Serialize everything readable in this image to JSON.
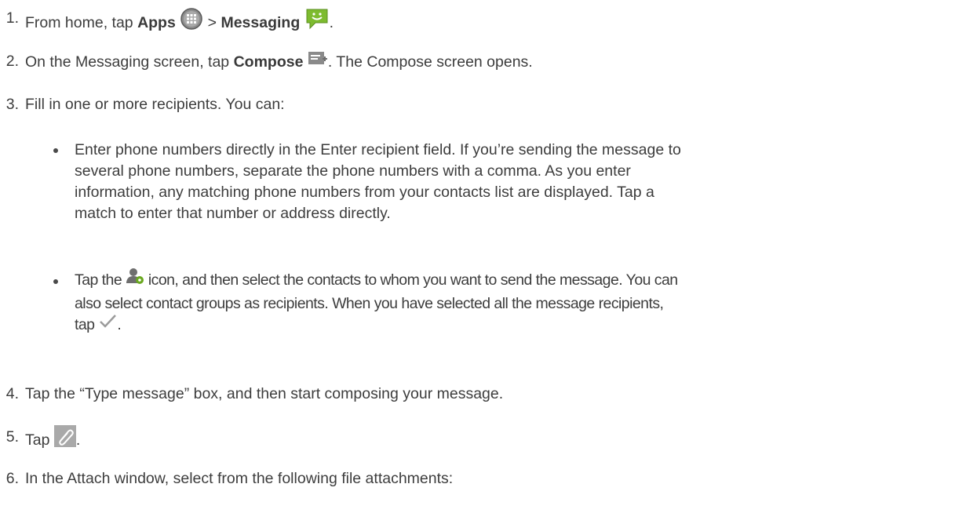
{
  "steps": [
    {
      "number": "1.",
      "parts": {
        "prefix": "From home, tap ",
        "bold1": "Apps",
        "sep": " > ",
        "bold2": "Messaging",
        "suffix": "."
      },
      "icons": [
        "apps-icon",
        "messaging-icon"
      ]
    },
    {
      "number": "2.",
      "parts": {
        "prefix": "On the Messaging screen, tap ",
        "bold1": "Compose",
        "suffix": ". The Compose screen opens."
      },
      "icons": [
        "compose-icon"
      ]
    },
    {
      "number": "3.",
      "text": "Fill in one or more recipients. You can:",
      "bullets": [
        {
          "lines": [
            "Enter phone numbers directly in the Enter recipient field. If you’re sending the message to",
            "several phone numbers, separate the phone numbers with a comma. As you enter",
            "information, any matching phone numbers from your contacts list are displayed. Tap a",
            "match to enter that number or address directly."
          ]
        },
        {
          "parts": {
            "prefix": "Tap the ",
            "line1_rest": " icon, and then select the contacts to whom you want to send the message. You can",
            "line2": "also select contact groups as recipients. When you have selected all the message recipients,",
            "line3_prefix": "tap ",
            "line3_suffix": "."
          },
          "icons": [
            "add-contact-icon",
            "checkmark-icon"
          ]
        }
      ]
    },
    {
      "number": "4.",
      "text": "Tap the “Type message” box, and then start composing your message."
    },
    {
      "number": "5.",
      "parts": {
        "prefix": "Tap ",
        "suffix": "."
      },
      "icons": [
        "paperclip-icon"
      ]
    },
    {
      "number": "6.",
      "text": "In the Attach window, select from the following file attachments:"
    }
  ]
}
